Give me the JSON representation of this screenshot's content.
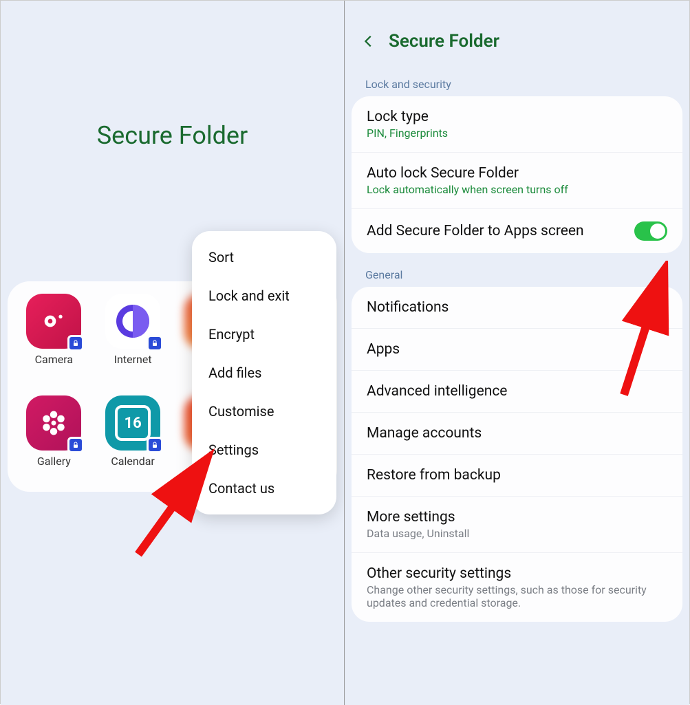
{
  "left": {
    "title": "Secure Folder",
    "apps": [
      {
        "label": "Camera"
      },
      {
        "label": "Internet"
      },
      {
        "label": "Gallery"
      },
      {
        "label": "Calendar",
        "day": "16"
      }
    ],
    "menu": {
      "sort": "Sort",
      "lock_exit": "Lock and exit",
      "encrypt": "Encrypt",
      "add_files": "Add files",
      "customise": "Customise",
      "settings": "Settings",
      "contact_us": "Contact us"
    }
  },
  "right": {
    "header": "Secure Folder",
    "sections": {
      "lock_security": "Lock and security",
      "general": "General"
    },
    "lock_type": {
      "title": "Lock type",
      "sub": "PIN, Fingerprints"
    },
    "auto_lock": {
      "title": "Auto lock Secure Folder",
      "sub": "Lock automatically when screen turns off"
    },
    "add_to_apps": {
      "title": "Add Secure Folder to Apps screen",
      "on": true
    },
    "notifications": "Notifications",
    "apps": "Apps",
    "adv_intel": "Advanced intelligence",
    "manage_accounts": "Manage accounts",
    "restore": "Restore from backup",
    "more_settings": {
      "title": "More settings",
      "sub": "Data usage, Uninstall"
    },
    "other_security": {
      "title": "Other security settings",
      "sub": "Change other security settings, such as those for security updates and credential storage."
    }
  }
}
